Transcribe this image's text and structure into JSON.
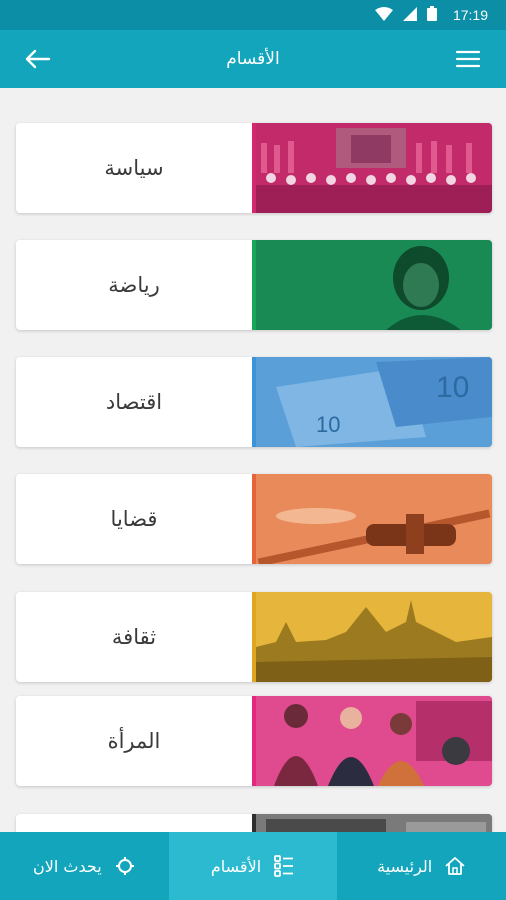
{
  "status_bar": {
    "time": "17:19",
    "icons": [
      "wifi-icon",
      "signal-icon",
      "battery-icon"
    ]
  },
  "app_bar": {
    "title": "الأقسام",
    "left_icon": "back-arrow-icon",
    "right_icon": "menu-icon"
  },
  "categories": [
    {
      "label": "سياسة",
      "accent": "#d3286f",
      "icon": "politics-thumbnail"
    },
    {
      "label": "رياضة",
      "accent": "#16a75a",
      "icon": "sports-thumbnail"
    },
    {
      "label": "اقتصاد",
      "accent": "#3c93d8",
      "icon": "economy-thumbnail"
    },
    {
      "label": "قضايا",
      "accent": "#e6643a",
      "icon": "issues-thumbnail"
    },
    {
      "label": "ثقافة",
      "accent": "#e2a520",
      "icon": "culture-thumbnail"
    },
    {
      "label": "المرأة",
      "accent": "#e6277e",
      "icon": "women-thumbnail"
    },
    {
      "label": "",
      "accent": "#2e2e2e",
      "icon": "partial-thumbnail"
    }
  ],
  "bottom_nav": {
    "items": [
      {
        "label": "الرئيسية",
        "icon": "home-icon",
        "active": false
      },
      {
        "label": "الأقسام",
        "icon": "sections-icon",
        "active": true
      },
      {
        "label": "يحدث الان",
        "icon": "target-icon",
        "active": false
      }
    ]
  },
  "colors": {
    "primary": "#12a5bc",
    "status": "#0b8ea6",
    "nav_active": "#2bbad0",
    "background": "#f1f1f1"
  }
}
